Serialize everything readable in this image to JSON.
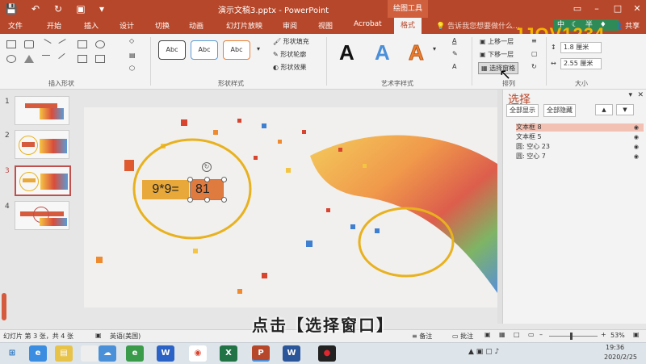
{
  "window": {
    "title": "演示文稿3.pptx - PowerPoint",
    "context_tab": "绘图工具"
  },
  "tabs": [
    "文件",
    "开始",
    "插入",
    "设计",
    "切换",
    "动画",
    "幻灯片放映",
    "审阅",
    "视图",
    "Acrobat",
    "格式"
  ],
  "active_tab": "格式",
  "tell_me": "告诉我您想要做什么...",
  "share": "共享",
  "ime": {
    "zh": "中",
    "half": "半"
  },
  "ribbon": {
    "groups": [
      "插入形状",
      "形状样式",
      "艺术字样式",
      "排列",
      "大小"
    ],
    "style_preview": [
      "Abc",
      "Abc",
      "Abc"
    ],
    "shape_fill": "形状填充",
    "shape_outline": "形状轮廓",
    "shape_effects": "形状效果",
    "bring_forward": "上移一层",
    "send_backward": "下移一层",
    "selection_pane": "选择窗格",
    "height": "1.8 厘米",
    "width": "2.55 厘米",
    "wordart_letter": "A"
  },
  "logo": "JJOV1234",
  "thumbnails": [
    "1",
    "2",
    "3",
    "4"
  ],
  "selected_slide": 3,
  "slide": {
    "equation": "9*9=",
    "answer": "81"
  },
  "selection_pane": {
    "title": "选择",
    "show_all": "全部显示",
    "hide_all": "全部隐藏",
    "up": "▲",
    "down": "▼",
    "items": [
      "文本框 8",
      "文本框 5",
      "圆: 空心 23",
      "圆: 空心 7"
    ],
    "highlighted": "文本框 8"
  },
  "status": {
    "slide_info": "幻灯片 第 3 张，共 4 张",
    "language": "英语(美国)",
    "notes": "备注",
    "comments": "批注",
    "zoom": "53%"
  },
  "subtitle": "点击【选择窗口】",
  "taskbar": {
    "time": "19:36",
    "date": "2020/2/25"
  },
  "colors": {
    "accent": "#b7472a",
    "circle": "#e8b11e",
    "equation_bg": "#e9a93a",
    "answer_bg": "#e07b3f"
  }
}
